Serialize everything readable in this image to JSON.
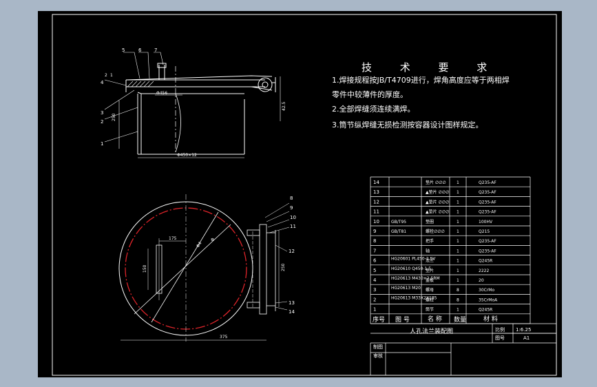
{
  "tech_requirements": {
    "title": "技 术 要 求",
    "line1a": "1.焊接规程按JB/T4709进行，焊角高度应等于两相焊",
    "line1b": "零件中较薄件的厚度。",
    "line2": "2.全部焊缝须连续满焊。",
    "line3": "3.筒节纵焊缝无损检测按容器设计图样规定。"
  },
  "front_view": {
    "callouts": [
      "5",
      "6",
      "7",
      "4",
      "3",
      "2",
      "1"
    ],
    "dims": {
      "left_stack_a": "2",
      "left_stack_b": "1",
      "height": "250",
      "bolt_dia": "Φ456",
      "width": "Φ450×12",
      "right_offset": "42.5"
    }
  },
  "plan_view": {
    "callouts": [
      "8",
      "9",
      "10",
      "11",
      "12",
      "13",
      "14"
    ],
    "dims": {
      "top": "175",
      "left": "150",
      "right": "250",
      "bottom": "375",
      "dia_a": "Φ4",
      "dia_b": "Φ"
    }
  },
  "bom": {
    "rows": [
      {
        "no": "14",
        "code": "",
        "name": "垫片 ∅∅∅",
        "qty": "1",
        "material": "Q235-AF"
      },
      {
        "no": "13",
        "code": "",
        "name": "▲垫片 ∅∅∅",
        "qty": "1",
        "material": "Q235-AF"
      },
      {
        "no": "12",
        "code": "",
        "name": "▲垫片 ∅∅∅",
        "qty": "1",
        "material": "Q235-AF"
      },
      {
        "no": "11",
        "code": "",
        "name": "▲垫片 ∅∅∅",
        "qty": "1",
        "material": "Q235-AF"
      },
      {
        "no": "10",
        "code": "GB/T95",
        "name": "垫圈",
        "qty": "1",
        "material": "100HV"
      },
      {
        "no": "9",
        "code": "GB/T81",
        "name": "螺栓∅∅∅",
        "qty": "1",
        "material": "Q215"
      },
      {
        "no": "8",
        "code": "",
        "name": "把手",
        "qty": "1",
        "material": "Q235-AF"
      },
      {
        "no": "7",
        "code": "",
        "name": "轴",
        "qty": "1",
        "material": "Q235-AF"
      },
      {
        "no": "6",
        "code": "HG20601 PL450-2.5V",
        "name": "法兰",
        "qty": "1",
        "material": "Q245R"
      },
      {
        "no": "5",
        "code": "HG20610 Q450-1.5",
        "name": "垫片",
        "qty": "1",
        "material": "2222"
      },
      {
        "no": "4",
        "code": "HG20613 M430×2.5RM",
        "name": "盖板",
        "qty": "1",
        "material": "20"
      },
      {
        "no": "3",
        "code": "HG20613 M20",
        "name": "螺母",
        "qty": "8",
        "material": "30CrMo"
      },
      {
        "no": "2",
        "code": "HG20613 M33X2X185",
        "name": "螺柱",
        "qty": "8",
        "material": "35CrMoA"
      },
      {
        "no": "1",
        "code": "",
        "name": "筒节",
        "qty": "1",
        "material": "Q245R"
      }
    ],
    "headers": {
      "no": "序号",
      "code": "图 号",
      "name": "名 称",
      "qty": "数量",
      "material": "材 料"
    },
    "drawing_title": "人孔法兰装配图",
    "scale_label": "比例",
    "scale": "1:6.25",
    "sheet_label": "图号",
    "sheet": "A1",
    "drawn_label": "制图",
    "checked_label": "审核"
  }
}
